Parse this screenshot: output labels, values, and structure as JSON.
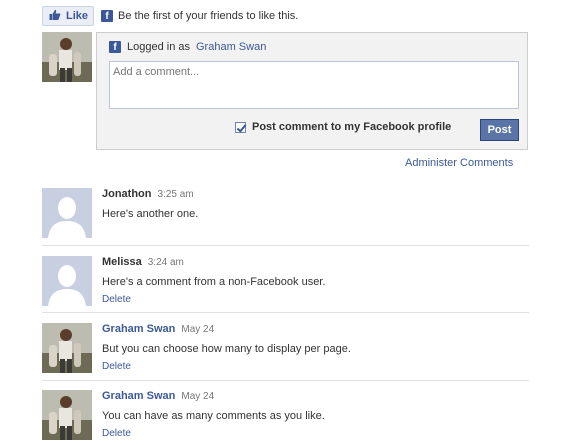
{
  "like": {
    "button_label": "Like",
    "social_text": "Be the first of your friends to like this."
  },
  "composer": {
    "logged_in_prefix": "Logged in as",
    "user_name": "Graham Swan",
    "placeholder": "Add a comment...",
    "post_to_profile_label": "Post comment to my Facebook profile",
    "post_to_profile_checked": true,
    "post_button_label": "Post"
  },
  "admin_link": "Administer Comments",
  "comments": [
    {
      "author": "Jonathon",
      "time": "3:25 am",
      "text": "Here's another one.",
      "delete_label": "",
      "avatar": "blank-silhouette"
    },
    {
      "author": "Melissa",
      "time": "3:24 am",
      "text": "Here's a comment from a non-Facebook user.",
      "delete_label": "Delete",
      "avatar": "blank-silhouette"
    },
    {
      "author": "Graham Swan",
      "time": "May 24",
      "text": "But you can choose how many to display per page.",
      "delete_label": "Delete",
      "avatar": "user-photo"
    },
    {
      "author": "Graham Swan",
      "time": "May 24",
      "text": "You can have as many comments as you like.",
      "delete_label": "Delete",
      "avatar": "user-photo"
    }
  ],
  "colors": {
    "facebook_blue": "#3b5998",
    "post_button": "#5b74a8",
    "composer_bg": "#f2f2f2"
  }
}
